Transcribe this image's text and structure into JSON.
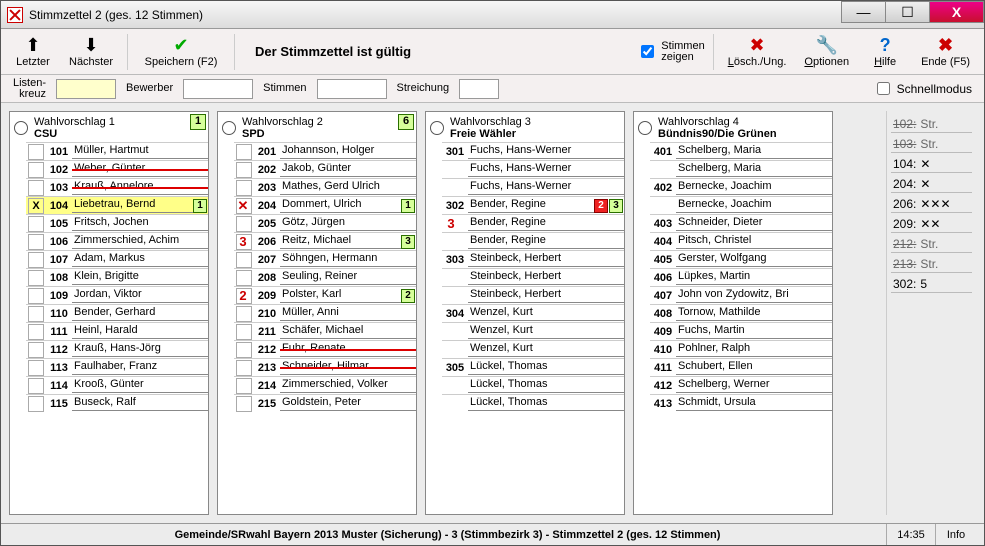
{
  "window": {
    "title": "Stimmzettel 2  (ges. 12 Stimmen)"
  },
  "winbtns": {
    "min": "—",
    "max": "☐",
    "close": "X"
  },
  "toolbar": {
    "prev": "Letzter",
    "next": "Nächster",
    "save": "Speichern (F2)",
    "status": "Der Stimmzettel ist gültig",
    "show_votes": "Stimmen\nzeigen",
    "delete": "Lösch./Ung.",
    "options": "Optionen",
    "help": "Hilfe",
    "end": "Ende (F5)"
  },
  "fields": {
    "listenkreuz": "Listen-\nkreuz",
    "bewerber": "Bewerber",
    "stimmen": "Stimmen",
    "streichung": "Streichung",
    "schnell": "Schnellmodus"
  },
  "columns": [
    {
      "idx": 0,
      "title": "Wahlvorschlag 1",
      "sub": "CSU",
      "count": "1",
      "rows": [
        {
          "id": "101",
          "name": "Müller, Hartmut"
        },
        {
          "id": "102",
          "name": "Weber, Günter",
          "struck": true
        },
        {
          "id": "103",
          "name": "Krauß, Annelore",
          "struck": true
        },
        {
          "id": "104",
          "name": "Liebetrau, Bernd",
          "mark": "X",
          "hl": true,
          "tag": "1"
        },
        {
          "id": "105",
          "name": "Fritsch, Jochen"
        },
        {
          "id": "106",
          "name": "Zimmerschied, Achim"
        },
        {
          "id": "107",
          "name": "Adam, Markus"
        },
        {
          "id": "108",
          "name": "Klein, Brigitte"
        },
        {
          "id": "109",
          "name": "Jordan, Viktor"
        },
        {
          "id": "110",
          "name": "Bender, Gerhard"
        },
        {
          "id": "111",
          "name": "Heinl, Harald"
        },
        {
          "id": "112",
          "name": "Krauß, Hans-Jörg"
        },
        {
          "id": "113",
          "name": "Faulhaber, Franz"
        },
        {
          "id": "114",
          "name": "Krooß, Günter"
        },
        {
          "id": "115",
          "name": "Buseck, Ralf"
        }
      ]
    },
    {
      "idx": 1,
      "title": "Wahlvorschlag 2",
      "sub": "SPD",
      "count": "6",
      "rows": [
        {
          "id": "201",
          "name": "Johannson, Holger"
        },
        {
          "id": "202",
          "name": "Jakob, Günter"
        },
        {
          "id": "203",
          "name": "Mathes, Gerd Ulrich"
        },
        {
          "id": "204",
          "name": "Dommert, Ulrich",
          "prefix": "✕",
          "tag": "1"
        },
        {
          "id": "205",
          "name": "Götz, Jürgen"
        },
        {
          "id": "206",
          "name": "Reitz, Michael",
          "prefix": "3",
          "tag": "3"
        },
        {
          "id": "207",
          "name": "Söhngen, Hermann"
        },
        {
          "id": "208",
          "name": "Seuling, Reiner"
        },
        {
          "id": "209",
          "name": "Polster, Karl",
          "prefix": "2",
          "tag": "2"
        },
        {
          "id": "210",
          "name": "Müller, Anni"
        },
        {
          "id": "211",
          "name": "Schäfer, Michael"
        },
        {
          "id": "212",
          "name": "Fuhr, Renate",
          "struck": true
        },
        {
          "id": "213",
          "name": "Schneider, Hilmar",
          "struck": true
        },
        {
          "id": "214",
          "name": "Zimmerschied, Volker"
        },
        {
          "id": "215",
          "name": "Goldstein, Peter"
        }
      ]
    },
    {
      "idx": 2,
      "title": "Wahlvorschlag 3",
      "sub": "Freie Wähler",
      "count": "",
      "rows": [
        {
          "id": "301",
          "name": "Fuchs, Hans-Werner"
        },
        {
          "id": "",
          "name": "Fuchs, Hans-Werner",
          "noid": true
        },
        {
          "id": "",
          "name": "Fuchs, Hans-Werner",
          "noid": true
        },
        {
          "id": "302",
          "name": "Bender, Regine",
          "tag": "3",
          "redtag": "2",
          "prefix": ""
        },
        {
          "id": "",
          "name": "Bender, Regine",
          "noid": true,
          "prefix": "3"
        },
        {
          "id": "",
          "name": "Bender, Regine",
          "noid": true
        },
        {
          "id": "303",
          "name": "Steinbeck, Herbert"
        },
        {
          "id": "",
          "name": "Steinbeck, Herbert",
          "noid": true
        },
        {
          "id": "",
          "name": "Steinbeck, Herbert",
          "noid": true
        },
        {
          "id": "304",
          "name": "Wenzel, Kurt"
        },
        {
          "id": "",
          "name": "Wenzel, Kurt",
          "noid": true
        },
        {
          "id": "",
          "name": "Wenzel, Kurt",
          "noid": true
        },
        {
          "id": "305",
          "name": "Lückel, Thomas"
        },
        {
          "id": "",
          "name": "Lückel, Thomas",
          "noid": true
        },
        {
          "id": "",
          "name": "Lückel, Thomas",
          "noid": true
        }
      ]
    },
    {
      "idx": 3,
      "title": "Wahlvorschlag 4",
      "sub": "Bündnis90/Die Grünen",
      "count": "",
      "rows": [
        {
          "id": "401",
          "name": "Schelberg, Maria"
        },
        {
          "id": "",
          "name": "Schelberg, Maria",
          "noid": true
        },
        {
          "id": "402",
          "name": "Bernecke, Joachim"
        },
        {
          "id": "",
          "name": "Bernecke, Joachim",
          "noid": true
        },
        {
          "id": "403",
          "name": "Schneider, Dieter"
        },
        {
          "id": "404",
          "name": "Pitsch, Christel"
        },
        {
          "id": "405",
          "name": "Gerster, Wolfgang"
        },
        {
          "id": "406",
          "name": "Lüpkes, Martin"
        },
        {
          "id": "407",
          "name": "John von Zydowitz, Bri"
        },
        {
          "id": "408",
          "name": "Tornow, Mathilde"
        },
        {
          "id": "409",
          "name": "Fuchs, Martin"
        },
        {
          "id": "410",
          "name": "Pohlner, Ralph"
        },
        {
          "id": "411",
          "name": "Schubert, Ellen"
        },
        {
          "id": "412",
          "name": "Schelberg, Werner"
        },
        {
          "id": "413",
          "name": "Schmidt, Ursula"
        }
      ]
    }
  ],
  "side": [
    {
      "label": "102:",
      "val": "Str.",
      "struck": true
    },
    {
      "label": "103:",
      "val": "Str.",
      "struck": true
    },
    {
      "label": "104:",
      "val": "✕"
    },
    {
      "label": "204:",
      "val": "✕"
    },
    {
      "label": "206:",
      "val": "✕✕✕"
    },
    {
      "label": "209:",
      "val": "✕✕"
    },
    {
      "label": "212:",
      "val": "Str.",
      "struck": true
    },
    {
      "label": "213:",
      "val": "Str.",
      "struck": true
    },
    {
      "label": "302:",
      "val": "5"
    }
  ],
  "footer": {
    "status": "Gemeinde/SRwahl Bayern 2013 Muster (Sicherung) - 3   (Stimmbezirk 3) - Stimmzettel 2  (ges. 12 Stimmen)",
    "clock": "14:35",
    "info": "Info"
  }
}
